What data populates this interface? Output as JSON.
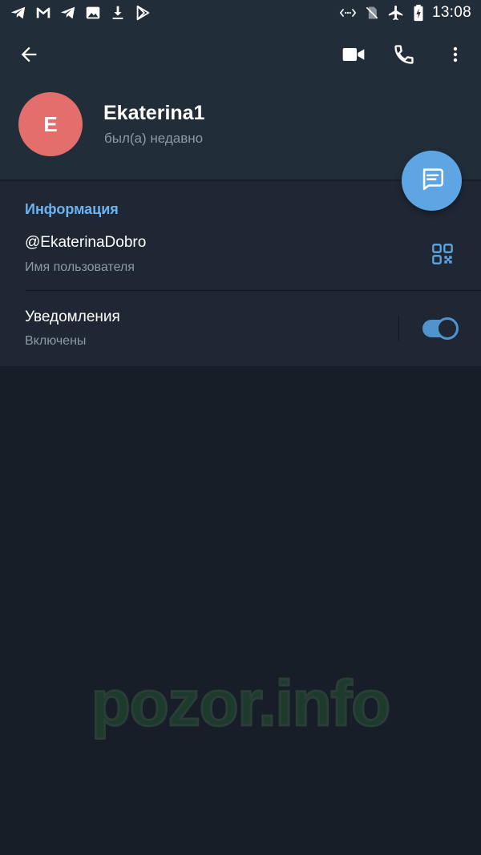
{
  "status_bar": {
    "time": "13:08",
    "left_icons": [
      "telegram-icon",
      "gmail-icon",
      "telegram-icon",
      "gallery-icon",
      "download-icon",
      "play-store-icon"
    ],
    "right_icons": [
      "data-saver-icon",
      "no-sim-icon",
      "airplane-icon",
      "battery-icon"
    ]
  },
  "header": {
    "back_icon": "arrow-back-icon",
    "actions": [
      "video-call-icon",
      "phone-icon",
      "more-vertical-icon"
    ]
  },
  "profile": {
    "avatar_letter": "E",
    "avatar_color": "#e36f6c",
    "name": "Ekaterina1",
    "last_seen": "был(а) недавно"
  },
  "fab": {
    "icon": "message-icon",
    "color": "#5ea6e3"
  },
  "info": {
    "title": "Информация",
    "username": "@EkaterinaDobro",
    "username_caption": "Имя пользователя",
    "qr_icon": "qr-code-icon",
    "notifications_label": "Уведомления",
    "notifications_status": "Включены",
    "notifications_enabled": true
  },
  "watermark": "pozor.info",
  "colors": {
    "background": "#171e28",
    "header": "#222d3a",
    "section": "#1e2733",
    "accent": "#6cb3f0",
    "secondary_text": "#8f9aa6"
  }
}
